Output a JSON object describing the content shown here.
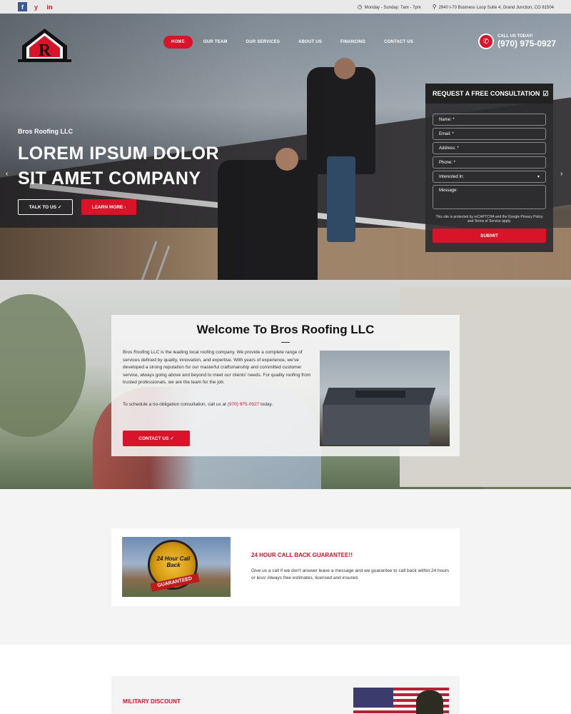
{
  "topbar": {
    "social": [
      "f",
      "y",
      "in"
    ],
    "hours": "Monday - Sunday: 7am - 7pm",
    "address": "2940 I-70 Business Loop Suite 4, Grand Junction, CO 81504"
  },
  "nav": {
    "items": [
      "HOME",
      "OUR TEAM",
      "OUR SERVICES",
      "ABOUT US",
      "FINANCING",
      "CONTACT US"
    ],
    "call_label": "CALL US TODAY!",
    "call_number": "(970) 975-0927"
  },
  "hero": {
    "subtitle": "Bros Roofing LLC",
    "title": "LOREM IPSUM DOLOR SIT AMET COMPANY",
    "btn_talk": "TALK TO US ✓",
    "btn_learn": "LEARN MORE ›"
  },
  "form": {
    "title": "REQUEST A FREE CONSULTATION",
    "name": "Name: *",
    "email": "Email: *",
    "address": "Address: *",
    "phone": "Phone: *",
    "interested": "Interested In:",
    "message": "Message:",
    "captcha": "This site is protected by reCAPTCHA and the Google Privacy Policy and Terms of Service apply.",
    "submit": "SUBMIT"
  },
  "welcome": {
    "title": "Welcome To Bros Roofing LLC",
    "body": "Bros Roofing LLC is the leading local roofing company. We provide a complete range of services defined by quality, innovation, and expertise. With years of experience, we've developed a strong reputation for our masterful craftsmanship and committed customer service, always going above and beyond to meet our clients' needs. For quality roofing from trusted professionals, we are the team for the job.",
    "schedule_pre": "To schedule a no-obligation consultation, call us at ",
    "schedule_phone": "(970) 975-0927",
    "schedule_post": " today.",
    "contact_btn": "CONTACT US ✓"
  },
  "guarantee": {
    "seal_text": "24 Hour Call Back",
    "seal_ribbon": "GUARANTEED",
    "title": "24 HOUR CALL BACK GUARANTEE!!",
    "text": "Give us a call if we don't answer leave a message and we guarantee to call back within 24 hours or less! Always free estimates, licensed and insured."
  },
  "military": {
    "title": "MILITARY DISCOUNT"
  },
  "colors": {
    "accent": "#d9142a",
    "dark": "#222222"
  }
}
